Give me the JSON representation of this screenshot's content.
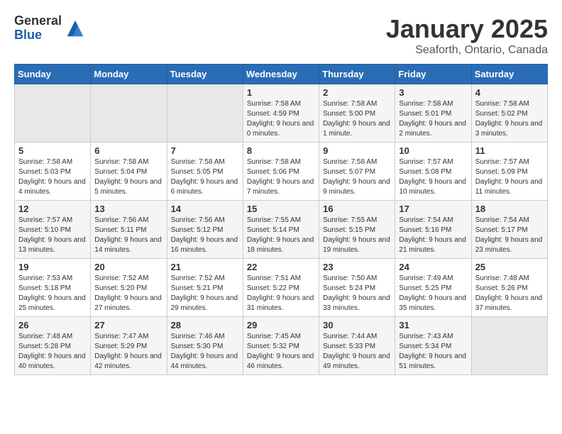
{
  "logo": {
    "general": "General",
    "blue": "Blue"
  },
  "title": "January 2025",
  "subtitle": "Seaforth, Ontario, Canada",
  "days_header": [
    "Sunday",
    "Monday",
    "Tuesday",
    "Wednesday",
    "Thursday",
    "Friday",
    "Saturday"
  ],
  "weeks": [
    [
      {
        "num": "",
        "empty": true
      },
      {
        "num": "",
        "empty": true
      },
      {
        "num": "",
        "empty": true
      },
      {
        "num": "1",
        "sunrise": "7:58 AM",
        "sunset": "4:59 PM",
        "daylight": "9 hours and 0 minutes."
      },
      {
        "num": "2",
        "sunrise": "7:58 AM",
        "sunset": "5:00 PM",
        "daylight": "9 hours and 1 minute."
      },
      {
        "num": "3",
        "sunrise": "7:58 AM",
        "sunset": "5:01 PM",
        "daylight": "9 hours and 2 minutes."
      },
      {
        "num": "4",
        "sunrise": "7:58 AM",
        "sunset": "5:02 PM",
        "daylight": "9 hours and 3 minutes."
      }
    ],
    [
      {
        "num": "5",
        "sunrise": "7:58 AM",
        "sunset": "5:03 PM",
        "daylight": "9 hours and 4 minutes."
      },
      {
        "num": "6",
        "sunrise": "7:58 AM",
        "sunset": "5:04 PM",
        "daylight": "9 hours and 5 minutes."
      },
      {
        "num": "7",
        "sunrise": "7:58 AM",
        "sunset": "5:05 PM",
        "daylight": "9 hours and 6 minutes."
      },
      {
        "num": "8",
        "sunrise": "7:58 AM",
        "sunset": "5:06 PM",
        "daylight": "9 hours and 7 minutes."
      },
      {
        "num": "9",
        "sunrise": "7:58 AM",
        "sunset": "5:07 PM",
        "daylight": "9 hours and 9 minutes."
      },
      {
        "num": "10",
        "sunrise": "7:57 AM",
        "sunset": "5:08 PM",
        "daylight": "9 hours and 10 minutes."
      },
      {
        "num": "11",
        "sunrise": "7:57 AM",
        "sunset": "5:09 PM",
        "daylight": "9 hours and 11 minutes."
      }
    ],
    [
      {
        "num": "12",
        "sunrise": "7:57 AM",
        "sunset": "5:10 PM",
        "daylight": "9 hours and 13 minutes."
      },
      {
        "num": "13",
        "sunrise": "7:56 AM",
        "sunset": "5:11 PM",
        "daylight": "9 hours and 14 minutes."
      },
      {
        "num": "14",
        "sunrise": "7:56 AM",
        "sunset": "5:12 PM",
        "daylight": "9 hours and 16 minutes."
      },
      {
        "num": "15",
        "sunrise": "7:55 AM",
        "sunset": "5:14 PM",
        "daylight": "9 hours and 18 minutes."
      },
      {
        "num": "16",
        "sunrise": "7:55 AM",
        "sunset": "5:15 PM",
        "daylight": "9 hours and 19 minutes."
      },
      {
        "num": "17",
        "sunrise": "7:54 AM",
        "sunset": "5:16 PM",
        "daylight": "9 hours and 21 minutes."
      },
      {
        "num": "18",
        "sunrise": "7:54 AM",
        "sunset": "5:17 PM",
        "daylight": "9 hours and 23 minutes."
      }
    ],
    [
      {
        "num": "19",
        "sunrise": "7:53 AM",
        "sunset": "5:18 PM",
        "daylight": "9 hours and 25 minutes."
      },
      {
        "num": "20",
        "sunrise": "7:52 AM",
        "sunset": "5:20 PM",
        "daylight": "9 hours and 27 minutes."
      },
      {
        "num": "21",
        "sunrise": "7:52 AM",
        "sunset": "5:21 PM",
        "daylight": "9 hours and 29 minutes."
      },
      {
        "num": "22",
        "sunrise": "7:51 AM",
        "sunset": "5:22 PM",
        "daylight": "9 hours and 31 minutes."
      },
      {
        "num": "23",
        "sunrise": "7:50 AM",
        "sunset": "5:24 PM",
        "daylight": "9 hours and 33 minutes."
      },
      {
        "num": "24",
        "sunrise": "7:49 AM",
        "sunset": "5:25 PM",
        "daylight": "9 hours and 35 minutes."
      },
      {
        "num": "25",
        "sunrise": "7:48 AM",
        "sunset": "5:26 PM",
        "daylight": "9 hours and 37 minutes."
      }
    ],
    [
      {
        "num": "26",
        "sunrise": "7:48 AM",
        "sunset": "5:28 PM",
        "daylight": "9 hours and 40 minutes."
      },
      {
        "num": "27",
        "sunrise": "7:47 AM",
        "sunset": "5:29 PM",
        "daylight": "9 hours and 42 minutes."
      },
      {
        "num": "28",
        "sunrise": "7:46 AM",
        "sunset": "5:30 PM",
        "daylight": "9 hours and 44 minutes."
      },
      {
        "num": "29",
        "sunrise": "7:45 AM",
        "sunset": "5:32 PM",
        "daylight": "9 hours and 46 minutes."
      },
      {
        "num": "30",
        "sunrise": "7:44 AM",
        "sunset": "5:33 PM",
        "daylight": "9 hours and 49 minutes."
      },
      {
        "num": "31",
        "sunrise": "7:43 AM",
        "sunset": "5:34 PM",
        "daylight": "9 hours and 51 minutes."
      },
      {
        "num": "",
        "empty": true
      }
    ]
  ]
}
